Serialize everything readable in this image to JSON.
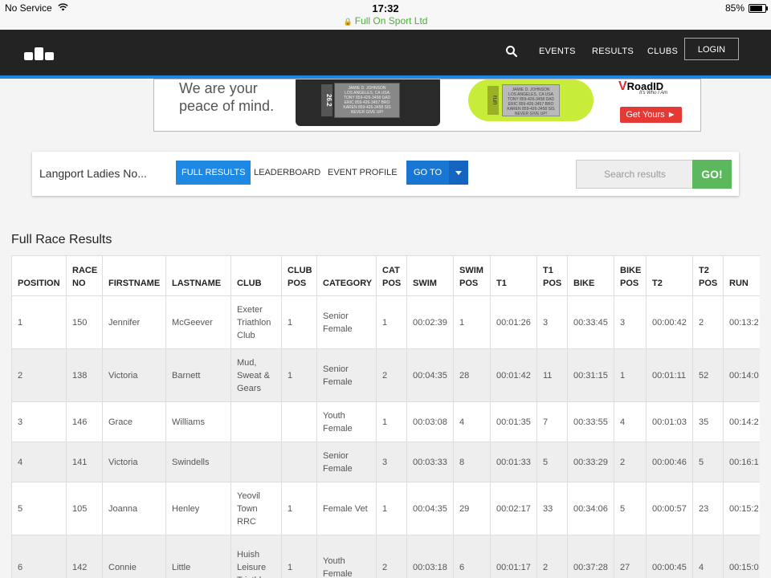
{
  "status_bar": {
    "carrier": "No Service",
    "time": "17:32",
    "site": "Full On Sport Ltd",
    "battery": "85%",
    "battery_level": 0.85
  },
  "nav": {
    "items": [
      "EVENTS",
      "RESULTS",
      "CLUBS"
    ],
    "login_label": "LOGIN"
  },
  "ad": {
    "tagline_1": "We are your",
    "tagline_2": "peace of mind.",
    "brand": "RoadID",
    "brand_sub": "It's Who I Am",
    "cta": "Get Yours",
    "band_tag_1": "26.2",
    "band_tag_2": "run",
    "plate_text": [
      "JAMIE D. JOHNSON",
      "LOS ANGELES, CA USA",
      "TONY 859-426-3458 DAD",
      "ERIC 859-426-3457 BRO",
      "KAREN 859-426-3458 SIS",
      "NEVER GIVE UP!"
    ]
  },
  "event": {
    "title": "Langport Ladies No...",
    "tabs": [
      "FULL RESULTS",
      "LEADERBOARD",
      "EVENT PROFILE"
    ],
    "goto_label": "GO TO",
    "search_placeholder": "Search results",
    "go_label": "GO!"
  },
  "results": {
    "title": "Full Race Results",
    "columns": [
      "POSITION",
      "RACE NO",
      "FIRSTNAME",
      "LASTNAME",
      "CLUB",
      "CLUB POS",
      "CATEGORY",
      "CAT POS",
      "SWIM",
      "SWIM POS",
      "T1",
      "T1 POS",
      "BIKE",
      "BIKE POS",
      "T2",
      "T2 POS",
      "RUN"
    ],
    "rows": [
      [
        "1",
        "150",
        "Jennifer",
        "McGeever",
        "Exeter Triathlon Club",
        "1",
        "Senior Female",
        "1",
        "00:02:39",
        "1",
        "00:01:26",
        "3",
        "00:33:45",
        "3",
        "00:00:42",
        "2",
        "00:13:2"
      ],
      [
        "2",
        "138",
        "Victoria",
        "Barnett",
        "Mud, Sweat & Gears",
        "1",
        "Senior Female",
        "2",
        "00:04:35",
        "28",
        "00:01:42",
        "11",
        "00:31:15",
        "1",
        "00:01:11",
        "52",
        "00:14:0"
      ],
      [
        "3",
        "146",
        "Grace",
        "Williams",
        "",
        "",
        "Youth Female",
        "1",
        "00:03:08",
        "4",
        "00:01:35",
        "7",
        "00:33:55",
        "4",
        "00:01:03",
        "35",
        "00:14:2"
      ],
      [
        "4",
        "141",
        "Victoria",
        "Swindells",
        "",
        "",
        "Senior Female",
        "3",
        "00:03:33",
        "8",
        "00:01:33",
        "5",
        "00:33:29",
        "2",
        "00:00:46",
        "5",
        "00:16:1"
      ],
      [
        "5",
        "105",
        "Joanna",
        "Henley",
        "Yeovil Town RRC",
        "1",
        "Female Vet",
        "1",
        "00:04:35",
        "29",
        "00:02:17",
        "33",
        "00:34:06",
        "5",
        "00:00:57",
        "23",
        "00:15:2"
      ],
      [
        "6",
        "142",
        "Connie",
        "Little",
        "Huish Leisure Triathlon",
        "1",
        "Youth Female",
        "2",
        "00:03:18",
        "6",
        "00:01:17",
        "2",
        "00:37:28",
        "27",
        "00:00:45",
        "4",
        "00:15:0"
      ]
    ]
  }
}
